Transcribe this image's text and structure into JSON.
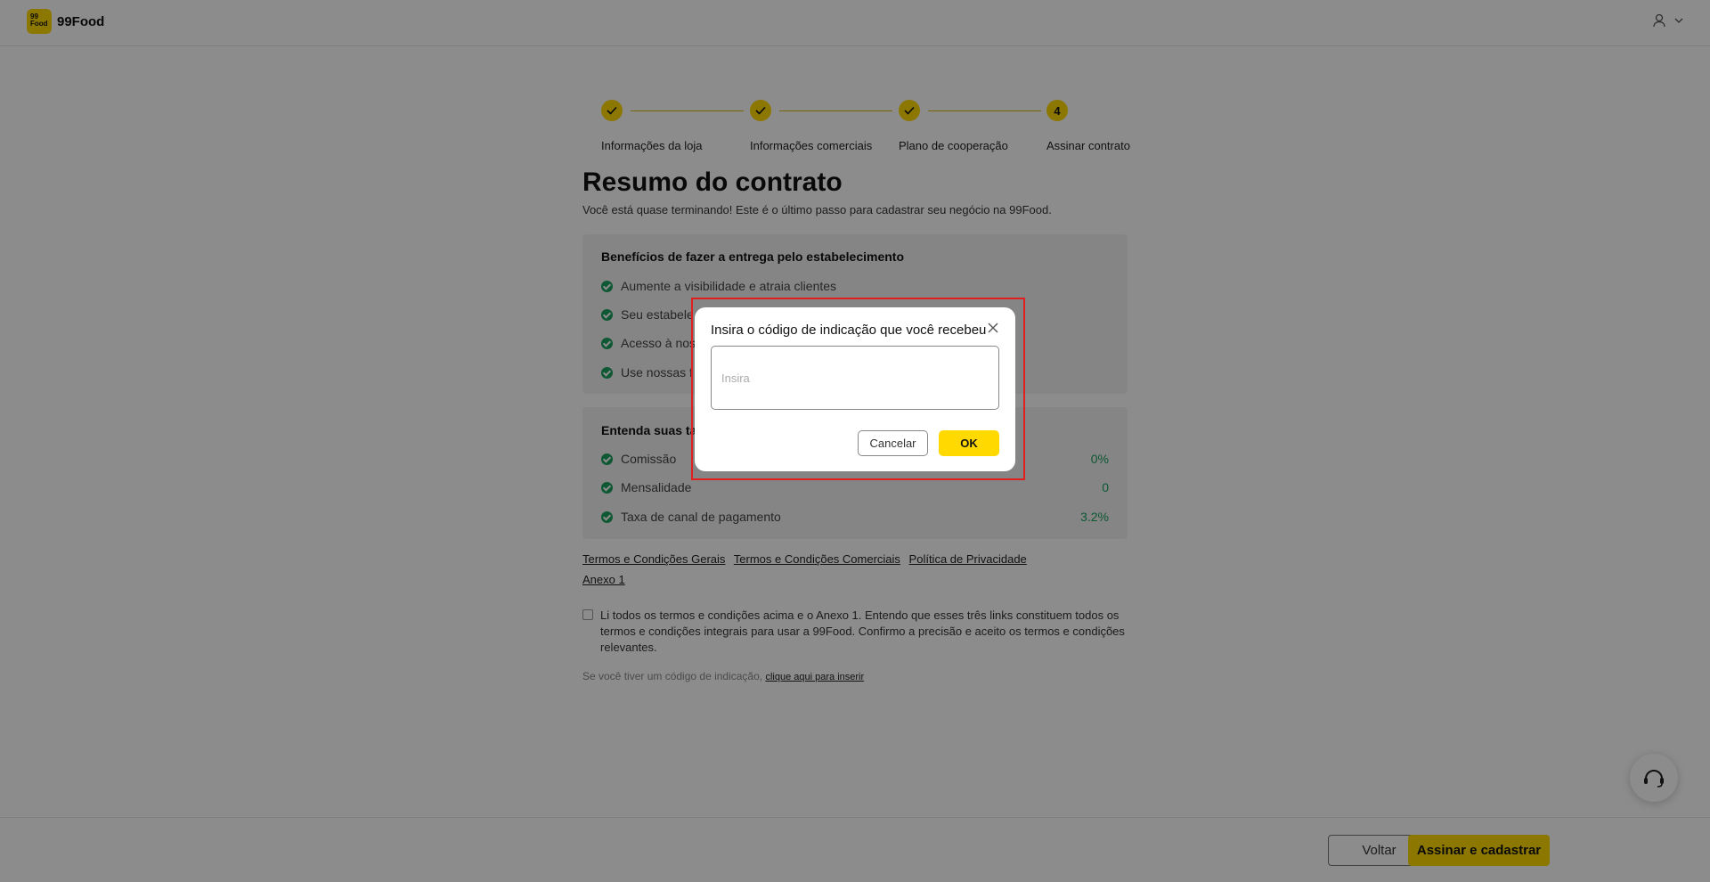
{
  "header": {
    "logo_mark": "99\nFood",
    "logo_text": "99Food"
  },
  "stepper": {
    "steps": [
      {
        "label": "Informações da loja",
        "state": "done"
      },
      {
        "label": "Informações comerciais",
        "state": "done"
      },
      {
        "label": "Plano de cooperação",
        "state": "done"
      },
      {
        "label": "Assinar contrato",
        "state": "current",
        "number": "4"
      }
    ]
  },
  "main": {
    "title": "Resumo do contrato",
    "subtitle": "Você está quase terminando! Este é o último passo para cadastrar seu negócio na 99Food.",
    "benefits": {
      "title": "Benefícios de fazer a entrega pelo estabelecimento",
      "items": [
        "Aumente a visibilidade e atraia clientes",
        "Seu estabele",
        "Acesso à nos",
        "Use nossas f"
      ]
    },
    "fees": {
      "title": "Entenda suas ta",
      "items": [
        {
          "label": "Comissão",
          "value": "0%"
        },
        {
          "label": "Mensalidade",
          "value": "0"
        },
        {
          "label": "Taxa de canal de pagamento",
          "value": "3.2%"
        }
      ]
    },
    "links": {
      "terms_general": "Termos e Condições Gerais",
      "terms_commercial": "Termos e Condições Comerciais",
      "privacy": "Política de Privacidade",
      "annex": "Anexo 1"
    },
    "agree_text": "Li todos os termos e condições acima e o Anexo 1. Entendo que esses três links constituem todos os termos e condições integrais para usar a 99Food. Confirmo a precisão e aceito os termos e condições relevantes.",
    "referral_prefix": "Se você tiver um código de indicação,",
    "referral_link": "clique aqui para inserir"
  },
  "footer": {
    "back_label": "Voltar",
    "sign_label": "Assinar e cadastrar"
  },
  "modal": {
    "title": "Insira o código de indicação que você recebeu",
    "input_value": "",
    "input_placeholder": "Insira",
    "cancel_label": "Cancelar",
    "ok_label": "OK"
  },
  "colors": {
    "brand": "#ffd900",
    "success": "#1ca060",
    "highlight": "#e0201e"
  }
}
